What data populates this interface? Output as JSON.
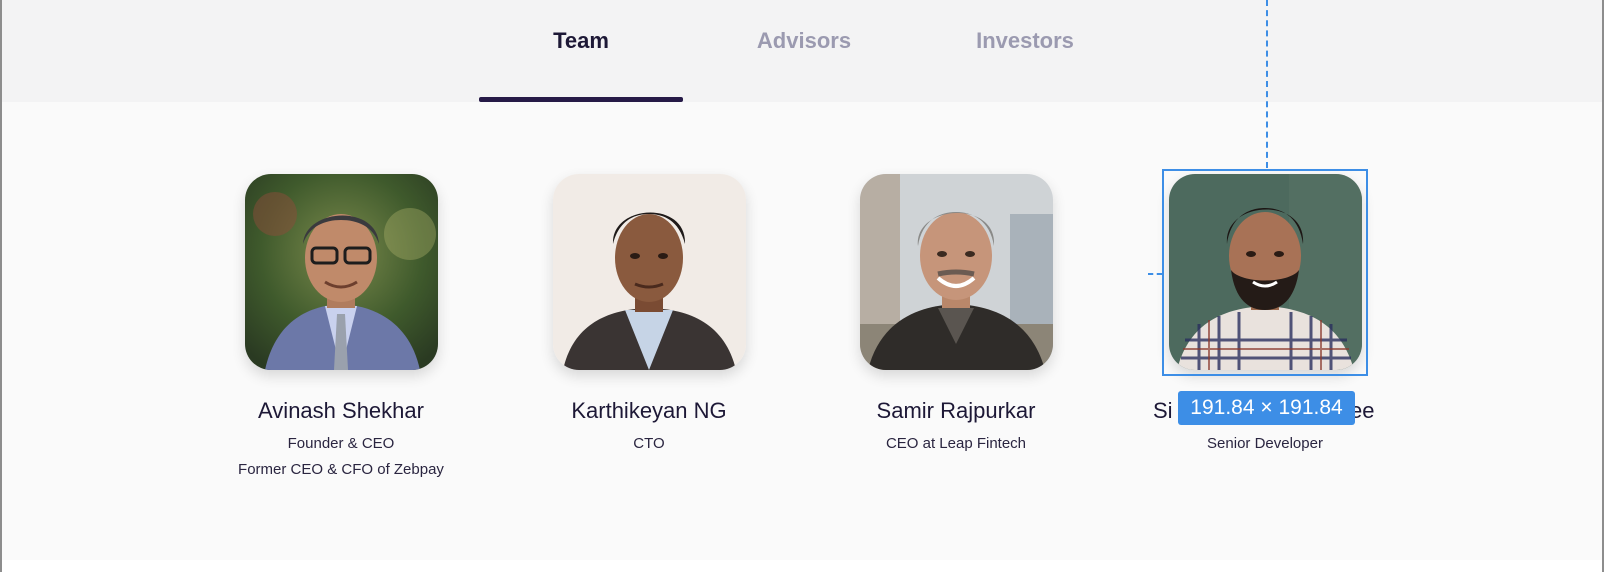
{
  "tabs": [
    {
      "label": "Team",
      "active": true
    },
    {
      "label": "Advisors",
      "active": false
    },
    {
      "label": "Investors",
      "active": false
    }
  ],
  "team": [
    {
      "name": "Avinash Shekhar",
      "lines": [
        "Founder & CEO",
        "Former CEO & CFO of Zebpay"
      ],
      "photo": "portrait-glasses-suit"
    },
    {
      "name": "Karthikeyan NG",
      "lines": [
        "CTO"
      ],
      "photo": "portrait-blazer"
    },
    {
      "name": "Samir Rajpurkar",
      "lines": [
        "CEO at Leap Fintech"
      ],
      "photo": "portrait-grey-hair"
    },
    {
      "name_visible_left": "Si",
      "name_visible_right": "ee",
      "lines": [
        "Senior Developer"
      ],
      "photo": "portrait-beard-checked-shirt"
    }
  ],
  "devtools": {
    "dimensions_label": "191.84 × 191.84",
    "accent_color": "#3d8ee6"
  },
  "colors": {
    "active_tab": "#1d1836",
    "inactive_tab": "#9b9ab0",
    "underline": "#261a47"
  }
}
